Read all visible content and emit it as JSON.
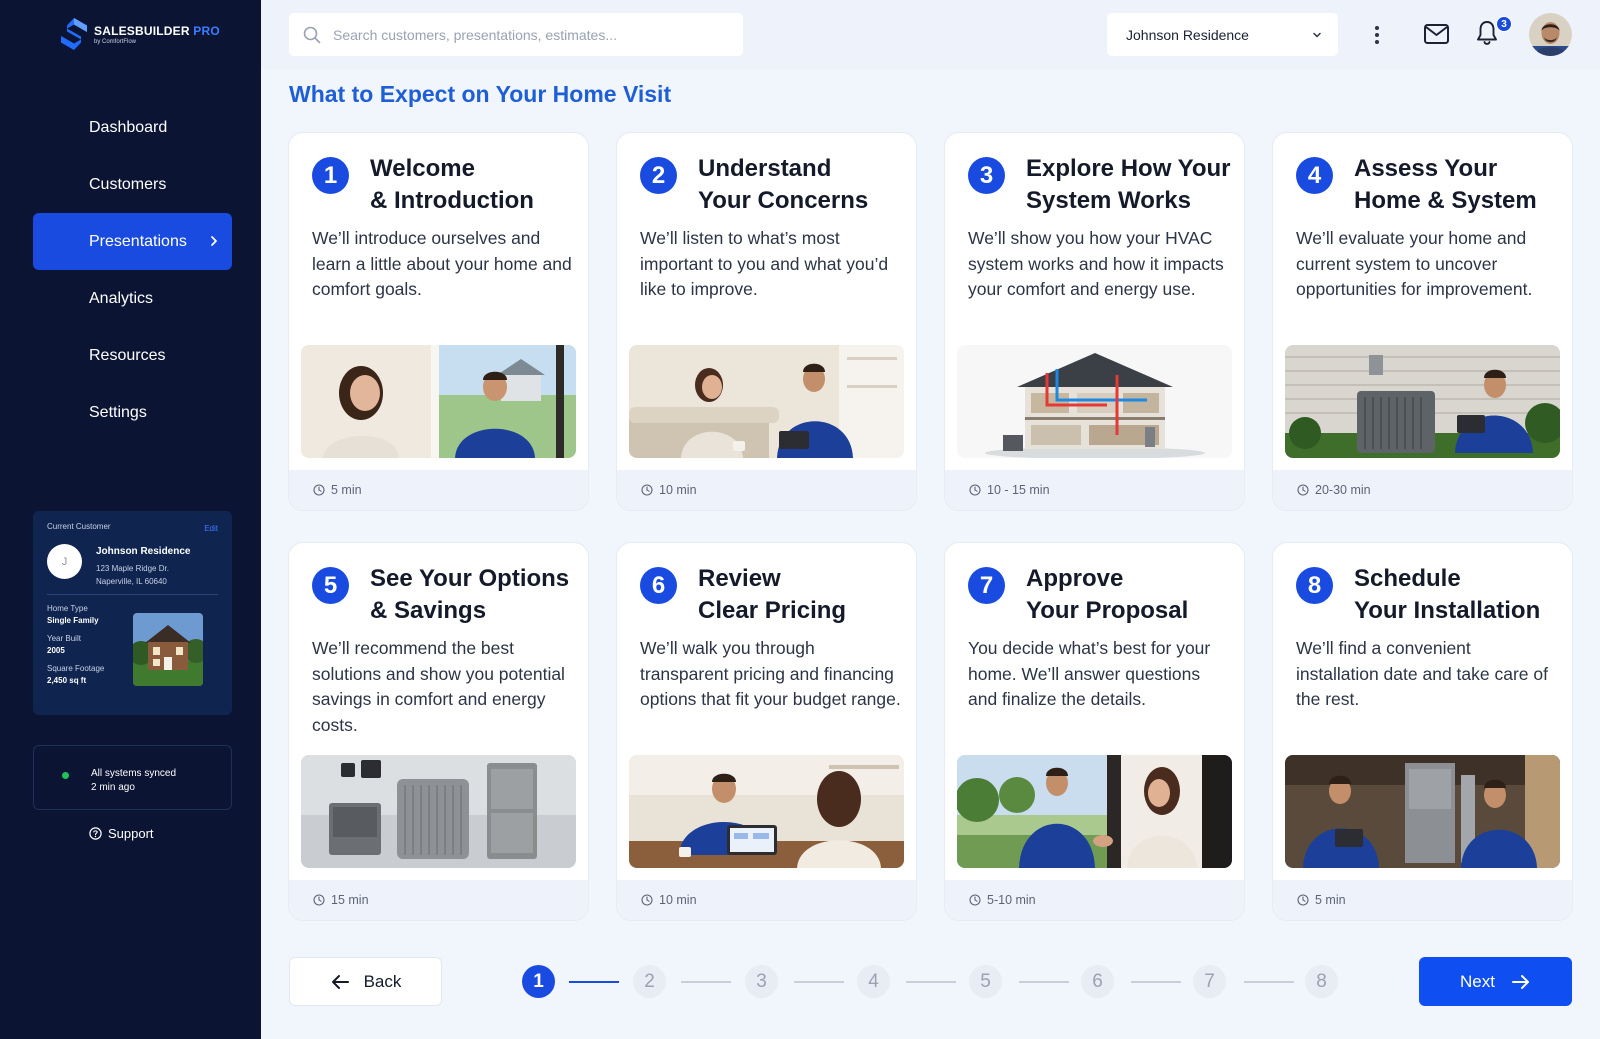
{
  "brand": {
    "name": "SALESBUILDER",
    "pro": "PRO",
    "sub": "by ComfortFlow"
  },
  "nav": {
    "items": [
      {
        "label": "Dashboard"
      },
      {
        "label": "Customers"
      },
      {
        "label": "Presentations"
      },
      {
        "label": "Analytics"
      },
      {
        "label": "Resources"
      },
      {
        "label": "Settings"
      }
    ],
    "active": "Presentations"
  },
  "current_customer": {
    "heading": "Current Customer",
    "edit": "Edit",
    "initial": "J",
    "name": "Johnson Residence",
    "address_line1": "123 Maple Ridge Dr.",
    "address_line2": "Naperville, IL 60640",
    "home_type_label": "Home Type",
    "home_type": "Single Family",
    "year_built_label": "Year Built",
    "year_built": "2005",
    "sqft_label": "Square Footage",
    "sqft": "2,450 sq ft"
  },
  "sync": {
    "line1": "All systems synced",
    "line2": "2 min ago"
  },
  "support": {
    "label": "Support"
  },
  "topbar": {
    "search_placeholder": "Search customers, presentations, estimates...",
    "customer_select": "Johnson Residence",
    "notifications_count": "3"
  },
  "page": {
    "title": "What to Expect on Your Home Visit"
  },
  "steps": [
    {
      "num": "1",
      "title": "Welcome\n& Introduction",
      "desc": "We’ll introduce ourselves and learn a little about your home and comfort goals.",
      "time": "5 min"
    },
    {
      "num": "2",
      "title": "Understand\nYour Concerns",
      "desc": "We’ll listen to what’s most important to you and what you’d like to improve.",
      "time": "10 min"
    },
    {
      "num": "3",
      "title": "Explore How Your\nSystem Works",
      "desc": "We’ll show you how your HVAC system works and how it impacts your comfort and energy use.",
      "time": "10 - 15 min"
    },
    {
      "num": "4",
      "title": "Assess Your\nHome & System",
      "desc": "We’ll evaluate your home and current system to uncover opportunities for improvement.",
      "time": "20-30 min"
    },
    {
      "num": "5",
      "title": "See Your Options\n& Savings",
      "desc": "We’ll recommend the best solutions and show you potential savings in comfort and energy costs.",
      "time": "15 min"
    },
    {
      "num": "6",
      "title": "Review\nClear Pricing",
      "desc": "We’ll walk you through transparent pricing and financing options that fit your budget range.",
      "time": "10 min"
    },
    {
      "num": "7",
      "title": "Approve\nYour Proposal",
      "desc": "You decide what’s best for your home. We’ll answer questions and finalize the details.",
      "time": "5-10 min"
    },
    {
      "num": "8",
      "title": "Schedule\nYour Installation",
      "desc": "We’ll find a convenient installation date and take care of the rest.",
      "time": "5 min"
    }
  ],
  "pager": {
    "back": "Back",
    "next": "Next",
    "steps": [
      "1",
      "2",
      "3",
      "4",
      "5",
      "6",
      "7",
      "8"
    ],
    "current": 1
  },
  "colors": {
    "sidebar": "#0b1533",
    "accent": "#1a4be0",
    "page_bg": "#f1f5fc",
    "title_blue": "#1f5fd6",
    "sync_green": "#20c15a"
  }
}
